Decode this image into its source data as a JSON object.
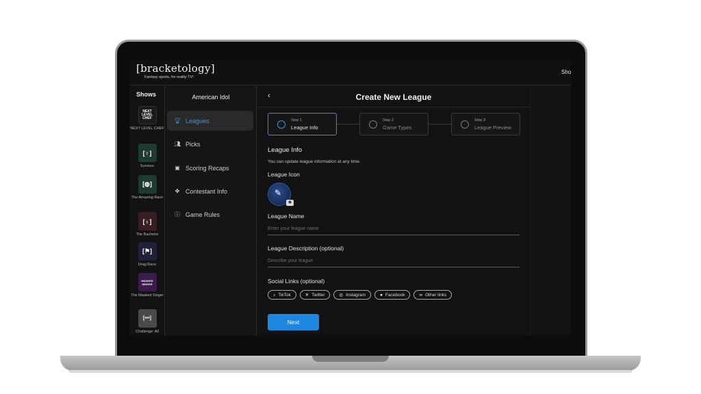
{
  "app": {
    "logo": "[bracketology]",
    "tagline": "Fantasy sports, for reality TV!",
    "top_nav_label": "Sho"
  },
  "shows": {
    "title": "Shows",
    "items": [
      {
        "name": "NEXT LEVEL CHEF",
        "thumb": "NEXT LEVEL CHEF",
        "color": "#1b1b1b"
      },
      {
        "name": "Survivor",
        "thumb": "[♀]",
        "color": "#1f3a2e"
      },
      {
        "name": "The Amazing Race",
        "thumb": "[◍]",
        "color": "#1f3a2e"
      },
      {
        "name": "The Bachelor",
        "thumb": "[♁]",
        "color": "#3a1f22"
      },
      {
        "name": "Drag Race",
        "thumb": "[⚑]",
        "color": "#202038"
      },
      {
        "name": "The Masked Singer",
        "thumb": "MASKED SINGER",
        "color": "#3a1b4a"
      },
      {
        "name": "Challenge: All",
        "thumb": "[•••]",
        "color": "#4a4a4a"
      }
    ]
  },
  "nav": {
    "title": "American Idol",
    "items": [
      {
        "label": "Leagues",
        "icon": "trophy-icon",
        "active": true
      },
      {
        "label": "Picks",
        "icon": "users-icon",
        "active": false
      },
      {
        "label": "Scoring Recaps",
        "icon": "tv-icon",
        "active": false
      },
      {
        "label": "Contestant Info",
        "icon": "paw-icon",
        "active": false
      },
      {
        "label": "Game Rules",
        "icon": "info-icon",
        "active": false
      }
    ]
  },
  "main": {
    "title": "Create New League",
    "steps": [
      {
        "num": "Step 1",
        "label": "League Info"
      },
      {
        "num": "Step 2",
        "label": "Game Types"
      },
      {
        "num": "Step 3",
        "label": "League Preview"
      }
    ],
    "section_title": "League Info",
    "section_hint": "You can update league information at any time.",
    "icon_label": "League Icon",
    "name_label": "League Name",
    "name_placeholder": "Enter your league name",
    "desc_label": "League Description (optional)",
    "desc_placeholder": "Describe your league",
    "social_label": "Social Links (optional)",
    "socials": [
      {
        "label": "TikTok",
        "icon": "tiktok-icon"
      },
      {
        "label": "Twitter",
        "icon": "x-icon"
      },
      {
        "label": "Instagram",
        "icon": "instagram-icon"
      },
      {
        "label": "Facebook",
        "icon": "facebook-icon"
      },
      {
        "label": "Other links",
        "icon": "link-icon"
      }
    ],
    "next_label": "Next"
  },
  "colors": {
    "accent": "#1e86de",
    "background": "#121212"
  }
}
